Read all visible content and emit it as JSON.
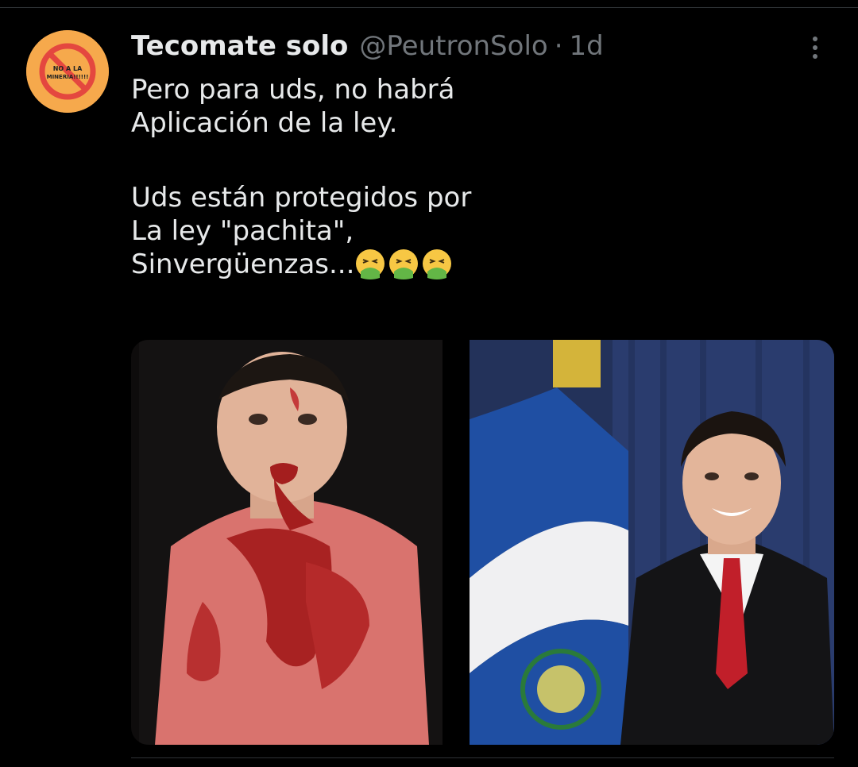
{
  "tweet": {
    "author": {
      "display_name": "Tecomate solo",
      "handle": "@PeutronSolo",
      "separator": "·",
      "time": "1d",
      "avatar_text_line1": "NO A LA",
      "avatar_text_line2": "MINERIA!!!!!!"
    },
    "text_lines": [
      "Pero para uds, no habrá",
      "Aplicación de la ley.",
      "Uds están protegidos por",
      "La ley \"pachita\",",
      "Sinvergüenzas..."
    ],
    "emojis": [
      "nauseated-vomiting-face",
      "nauseated-vomiting-face",
      "nauseated-vomiting-face"
    ],
    "media": [
      {
        "name": "photo-injured-man",
        "description_icon": "photo"
      },
      {
        "name": "photo-official-portrait",
        "description_icon": "photo"
      }
    ]
  },
  "colors": {
    "background": "#000000",
    "primary_text": "#e7e9ea",
    "secondary_text": "#71767b",
    "avatar_bg": "#f6a94c",
    "avatar_symbol": "#e4473f"
  }
}
